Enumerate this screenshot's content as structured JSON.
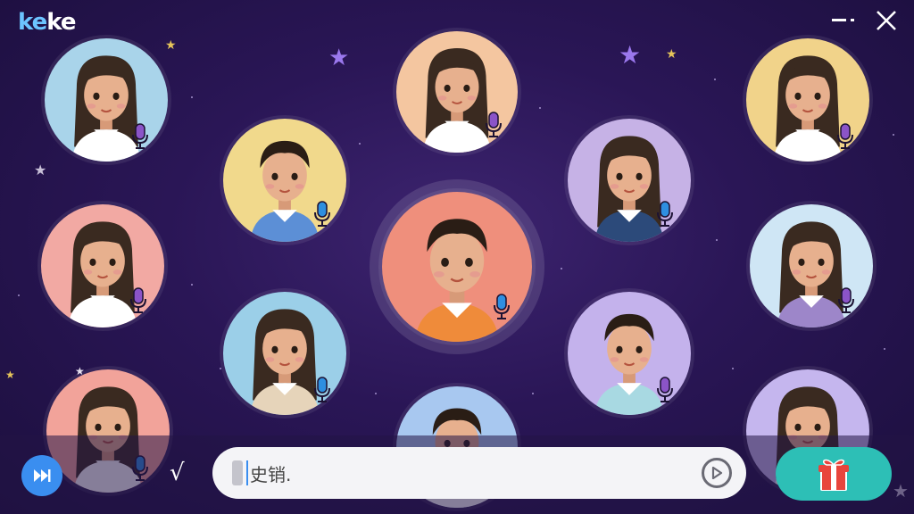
{
  "app": {
    "logo_part1": "ke",
    "logo_part2": "ke"
  },
  "window": {
    "minimize_label": "–·",
    "close_label": "✕"
  },
  "participants": [
    {
      "id": "p1",
      "bg": "#a9d4ea",
      "mic_color": "#8b54c8",
      "hair": "#3a2a20",
      "shirt": "#ffffff"
    },
    {
      "id": "p2",
      "bg": "#f4c6a0",
      "mic_color": "#8b54c8",
      "hair": "#3a2a20",
      "shirt": "#ffffff"
    },
    {
      "id": "p3",
      "bg": "#f1d38a",
      "mic_color": "#8b54c8",
      "hair": "#3a2a20",
      "shirt": "#ffffff"
    },
    {
      "id": "p4",
      "bg": "#f1d98c",
      "mic_color": "#2e8fe0",
      "hair": "#2a1d15",
      "shirt": "#5c8fd6"
    },
    {
      "id": "p5",
      "bg": "#c6b2e6",
      "mic_color": "#2e8fe0",
      "hair": "#3a2a20",
      "shirt": "#2c4a7a"
    },
    {
      "id": "p6",
      "bg": "#f2a9a3",
      "mic_color": "#8b54c8",
      "hair": "#3a2a20",
      "shirt": "#ffffff"
    },
    {
      "id": "p7",
      "bg": "#ef8f7c",
      "mic_color": "#2e8fe0",
      "hair": "#2a1d15",
      "shirt": "#ef8b3a"
    },
    {
      "id": "p8",
      "bg": "#cfe6f5",
      "mic_color": "#8b54c8",
      "hair": "#3a2a20",
      "shirt": "#9d86c9"
    },
    {
      "id": "p9",
      "bg": "#9bcfe8",
      "mic_color": "#2e8fe0",
      "hair": "#3a2a20",
      "shirt": "#e6d4ba"
    },
    {
      "id": "p10",
      "bg": "#c4b2ec",
      "mic_color": "#8b54c8",
      "hair": "#2a1d15",
      "shirt": "#a8d9e2"
    },
    {
      "id": "p11",
      "bg": "#f2a39a",
      "mic_color": "#2e8fe0",
      "hair": "#3a2a20",
      "shirt": "#ffffff"
    },
    {
      "id": "p12",
      "bg": "#a8c8f0",
      "mic_color": "#2e8fe0",
      "hair": "#2a1d15",
      "shirt": "#ffffff"
    },
    {
      "id": "p13",
      "bg": "#c5b6ee",
      "mic_color": "#8b54c8",
      "hair": "#3a2a20",
      "shirt": "#ffffff"
    }
  ],
  "bottom": {
    "check_label": "√",
    "chat_placeholder": "史销."
  }
}
